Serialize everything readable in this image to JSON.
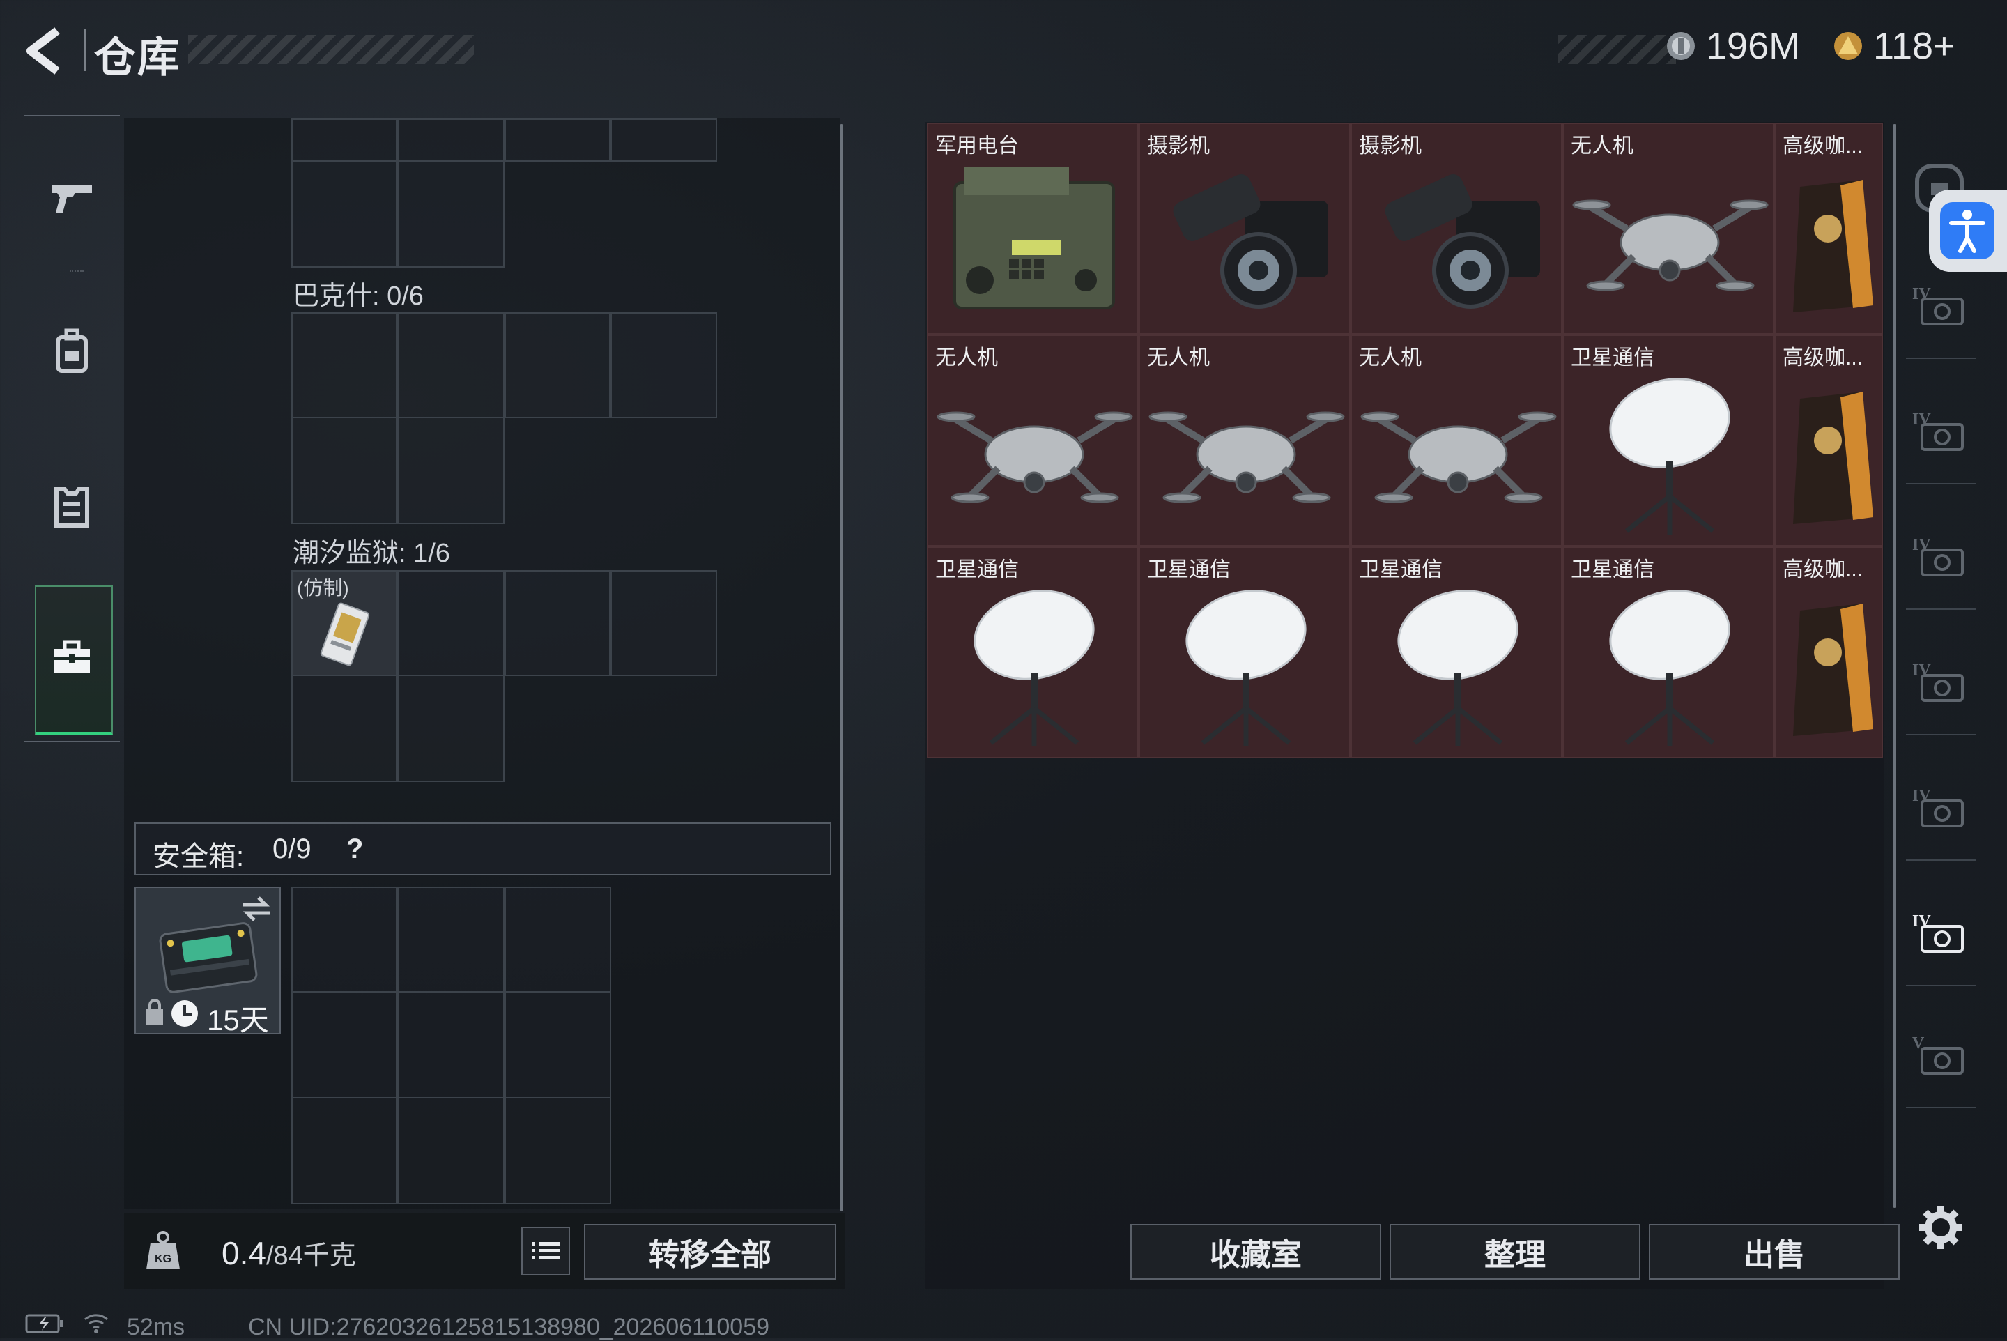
{
  "header": {
    "title": "仓库",
    "currency_silver": "196M",
    "currency_gold": "118+"
  },
  "nav": {
    "items": [
      "weapon-icon",
      "backpack-icon",
      "armor-icon",
      "toolbox-icon"
    ],
    "active": "toolbox-icon"
  },
  "left": {
    "section_bakesh": "巴克什: 0/6",
    "section_prison": "潮汐监狱: 1/6",
    "prison_item_label": "(仿制)",
    "safe_label": "安全箱:",
    "safe_count": "0/9",
    "safe_help": "?",
    "safe_timer": "15天",
    "weight_value": "0.4",
    "weight_capacity": "/84千克",
    "transfer_all": "转移全部"
  },
  "grid": {
    "items": [
      {
        "name": "军用电台",
        "icon": "radio"
      },
      {
        "name": "摄影机",
        "icon": "camera"
      },
      {
        "name": "摄影机",
        "icon": "camera"
      },
      {
        "name": "无人机",
        "icon": "drone"
      },
      {
        "name": "高级咖...",
        "icon": "coffee"
      },
      {
        "name": "无人机",
        "icon": "drone"
      },
      {
        "name": "无人机",
        "icon": "drone"
      },
      {
        "name": "无人机",
        "icon": "drone"
      },
      {
        "name": "卫星通信",
        "icon": "satellite"
      },
      {
        "name": "高级咖...",
        "icon": "coffee"
      },
      {
        "name": "卫星通信",
        "icon": "satellite"
      },
      {
        "name": "卫星通信",
        "icon": "satellite"
      },
      {
        "name": "卫星通信",
        "icon": "satellite"
      },
      {
        "name": "卫星通信",
        "icon": "satellite"
      },
      {
        "name": "高级咖...",
        "icon": "coffee"
      }
    ]
  },
  "actions": {
    "collection": "收藏室",
    "organize": "整理",
    "sell": "出售"
  },
  "side_tabs": [
    "IV",
    "IV",
    "IV",
    "IV",
    "IV",
    "IV",
    "V"
  ],
  "status": {
    "ping": "52ms",
    "uid": "CN UID:2762032612581513898​0_202606110059"
  },
  "colors": {
    "item_bg": "#3c2428",
    "accent_green": "#33d07f",
    "accessibility_blue": "#2f7cf6"
  }
}
